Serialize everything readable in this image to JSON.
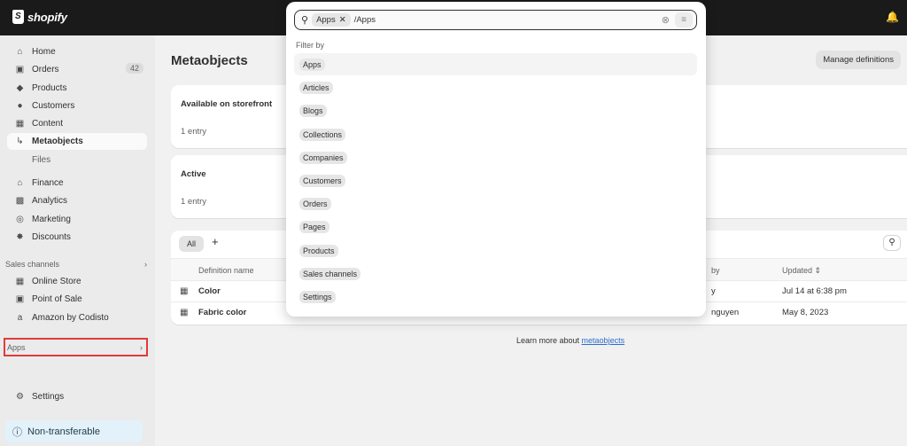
{
  "topbar": {
    "brand": "shopify"
  },
  "sidebar": {
    "items": [
      {
        "label": "Home",
        "icon": "home-icon"
      },
      {
        "label": "Orders",
        "icon": "inbox-icon",
        "badge": "42"
      },
      {
        "label": "Products",
        "icon": "tag-icon"
      },
      {
        "label": "Customers",
        "icon": "person-icon"
      },
      {
        "label": "Content",
        "icon": "image-icon"
      },
      {
        "label": "Metaobjects",
        "icon": "sub-arrow-icon"
      },
      {
        "label": "Files"
      },
      {
        "label": "Finance",
        "icon": "bank-icon"
      },
      {
        "label": "Analytics",
        "icon": "bar-chart-icon"
      },
      {
        "label": "Marketing",
        "icon": "target-icon"
      },
      {
        "label": "Discounts",
        "icon": "discount-icon"
      }
    ],
    "sales_channels": {
      "title": "Sales channels",
      "items": [
        {
          "label": "Online Store",
          "icon": "store-icon"
        },
        {
          "label": "Point of Sale",
          "icon": "pos-icon"
        },
        {
          "label": "Amazon by Codisto",
          "icon": "amazon-icon"
        }
      ]
    },
    "apps_label": "Apps",
    "settings_label": "Settings",
    "nontransferable_label": "Non-transferable"
  },
  "main": {
    "title": "Metaobjects",
    "manage_button": "Manage definitions",
    "cards": [
      {
        "title": "Available on storefront",
        "value": "1 entry"
      },
      {
        "title": "Active",
        "value": "1 entry"
      }
    ],
    "tabs": {
      "all": "All",
      "add": "+"
    },
    "table": {
      "headers": {
        "name": "Definition name",
        "by": "by",
        "updated": "Updated"
      },
      "rows": [
        {
          "name": "Color",
          "by": "y",
          "updated": "Jul 14 at 6:38 pm"
        },
        {
          "name": "Fabric color",
          "by": "nguyen",
          "updated": "May 8, 2023"
        }
      ]
    },
    "learn_more": {
      "prefix": "Learn more about ",
      "link": "metaobjects"
    }
  },
  "popover": {
    "search_chip": "Apps",
    "search_query": "/Apps",
    "filter_by_label": "Filter by",
    "options": [
      "Apps",
      "Articles",
      "Blogs",
      "Collections",
      "Companies",
      "Customers",
      "Orders",
      "Pages",
      "Products",
      "Sales channels",
      "Settings"
    ]
  }
}
